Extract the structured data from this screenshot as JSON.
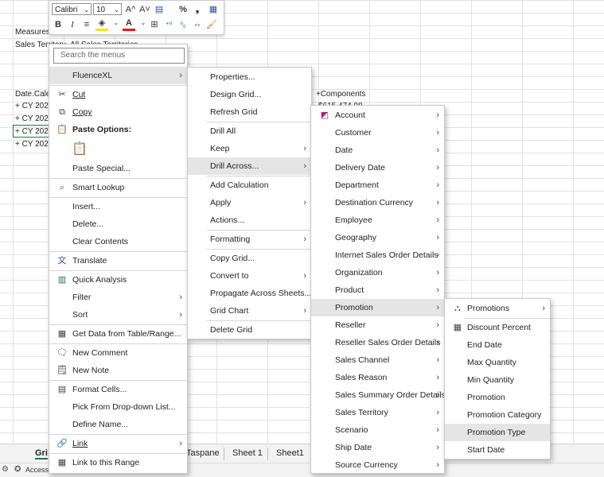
{
  "sheet": {
    "measures_label": "Measures",
    "territory_label": "Sales Territory",
    "territory_value": "All Sales Territories",
    "date_header": "Date.Cale",
    "components_header": "+Components",
    "components_value": "$615,474.98",
    "rows": [
      "+  CY 202",
      "+  CY 202",
      "+  CY 202",
      "+  CY 202"
    ]
  },
  "tabs": {
    "active": "Gri",
    "others": [
      "Taspane",
      "Sheet 1",
      "Sheet1"
    ]
  },
  "status": {
    "accessibility": "Accessi"
  },
  "mini_toolbar": {
    "font": "Calibri",
    "size": "10",
    "grow": "A^",
    "shrink": "A˅",
    "bold": "B",
    "italic": "I"
  },
  "context_menu": {
    "search_placeholder": "Search the menus",
    "fluence": "FluenceXL",
    "cut": "Cut",
    "copy": "Copy",
    "paste_options": "Paste Options:",
    "paste_special": "Paste Special...",
    "smart_lookup": "Smart Lookup",
    "insert": "Insert...",
    "delete": "Delete...",
    "clear_contents": "Clear Contents",
    "translate": "Translate",
    "quick_analysis": "Quick Analysis",
    "filter": "Filter",
    "sort": "Sort",
    "get_data": "Get Data from Table/Range...",
    "new_comment": "New Comment",
    "new_note": "New Note",
    "format_cells": "Format Cells...",
    "pick_dropdown": "Pick From Drop-down List...",
    "define_name": "Define Name...",
    "link": "Link",
    "link_range": "Link to this Range"
  },
  "fluence_menu": {
    "properties": "Properties...",
    "design_grid": "Design Grid...",
    "refresh_grid": "Refresh Grid",
    "drill_all": "Drill All",
    "keep": "Keep",
    "drill_across": "Drill Across...",
    "add_calculation": "Add Calculation",
    "apply": "Apply",
    "actions": "Actions...",
    "formatting": "Formatting",
    "copy_grid": "Copy Grid...",
    "convert_to": "Convert to",
    "propagate": "Propagate Across Sheets...",
    "grid_chart": "Grid Chart",
    "delete_grid": "Delete Grid"
  },
  "dimension_menu": {
    "items": [
      "Account",
      "Customer",
      "Date",
      "Delivery Date",
      "Department",
      "Destination Currency",
      "Employee",
      "Geography",
      "Internet Sales Order Details",
      "Organization",
      "Product",
      "Promotion",
      "Reseller",
      "Reseller Sales Order Details",
      "Sales Channel",
      "Sales Reason",
      "Sales Summary Order Details",
      "Sales Territory",
      "Scenario",
      "Ship Date",
      "Source Currency"
    ]
  },
  "promotion_menu": {
    "promotions": "Promotions",
    "items": [
      "Discount Percent",
      "End Date",
      "Max Quantity",
      "Min Quantity",
      "Promotion",
      "Promotion Category",
      "Promotion Type",
      "Start Date"
    ]
  },
  "colors": {
    "excel_green": "#217346",
    "highlight": "#e5e5e5"
  }
}
